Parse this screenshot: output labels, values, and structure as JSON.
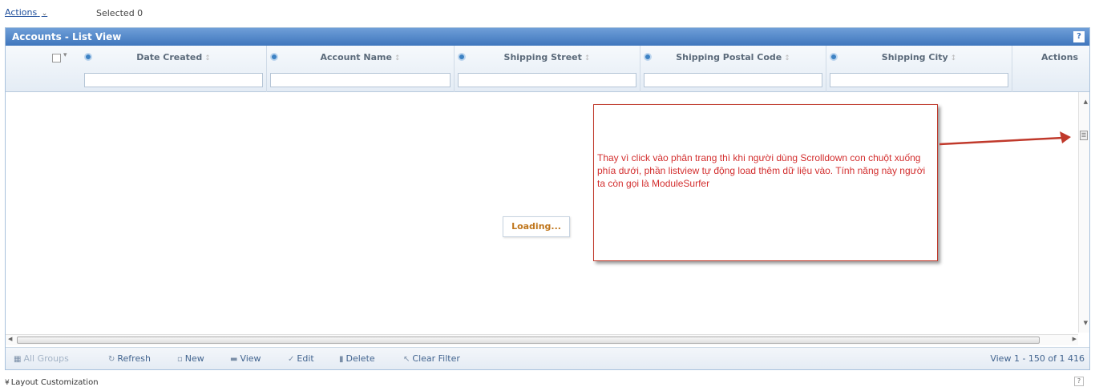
{
  "topbar": {
    "actions_label": "Actions",
    "actions_caret": "⌄",
    "selected_label": "Selected 0"
  },
  "grid": {
    "title": "Accounts - List View",
    "title_icon": "?",
    "select_caret": "▾",
    "columns": [
      {
        "title": "Date Created",
        "sort": "↕",
        "filter_value": ""
      },
      {
        "title": "Account Name",
        "sort": "↕",
        "filter_value": ""
      },
      {
        "title": "Shipping Street",
        "sort": "↕",
        "filter_value": ""
      },
      {
        "title": "Shipping Postal Code",
        "sort": "↕",
        "filter_value": ""
      },
      {
        "title": "Shipping City",
        "sort": "↕",
        "filter_value": ""
      }
    ],
    "actions_header": "Actions",
    "loading": "Loading...",
    "scroll": {
      "up": "▲",
      "down": "▼",
      "left": "◀",
      "right": "▶",
      "thumb": "☰"
    }
  },
  "toolbar": {
    "all_groups": "All Groups",
    "refresh": "Refresh",
    "new": "New",
    "view": "View",
    "edit": "Edit",
    "delete": "Delete",
    "clear_filter": "Clear Filter",
    "pager": "View 1 - 150 of 1 416"
  },
  "annotation": {
    "text": "Thay vì click vào phân trang thì khi người dùng Scrolldown con chuột xuống phía dưới, phần listview tự động load thêm dữ liệu vào. Tính năng này người ta còn gọi là ModuleSurfer"
  },
  "footer": {
    "layout_caret": "¥",
    "layout_label": "Layout Customization",
    "help_icon": "?"
  },
  "colors": {
    "title_bar": "#4a80c4",
    "annotation_red": "#d32f2f",
    "link_blue": "#1f4f9c",
    "loading_orange": "#c0771e"
  },
  "icons": {
    "refresh": "refresh-icon",
    "new": "new-icon",
    "view": "view-icon",
    "edit": "edit-icon",
    "delete": "delete-icon",
    "clear_filter": "clear-filter-icon",
    "column_settings": "gear-icon"
  }
}
